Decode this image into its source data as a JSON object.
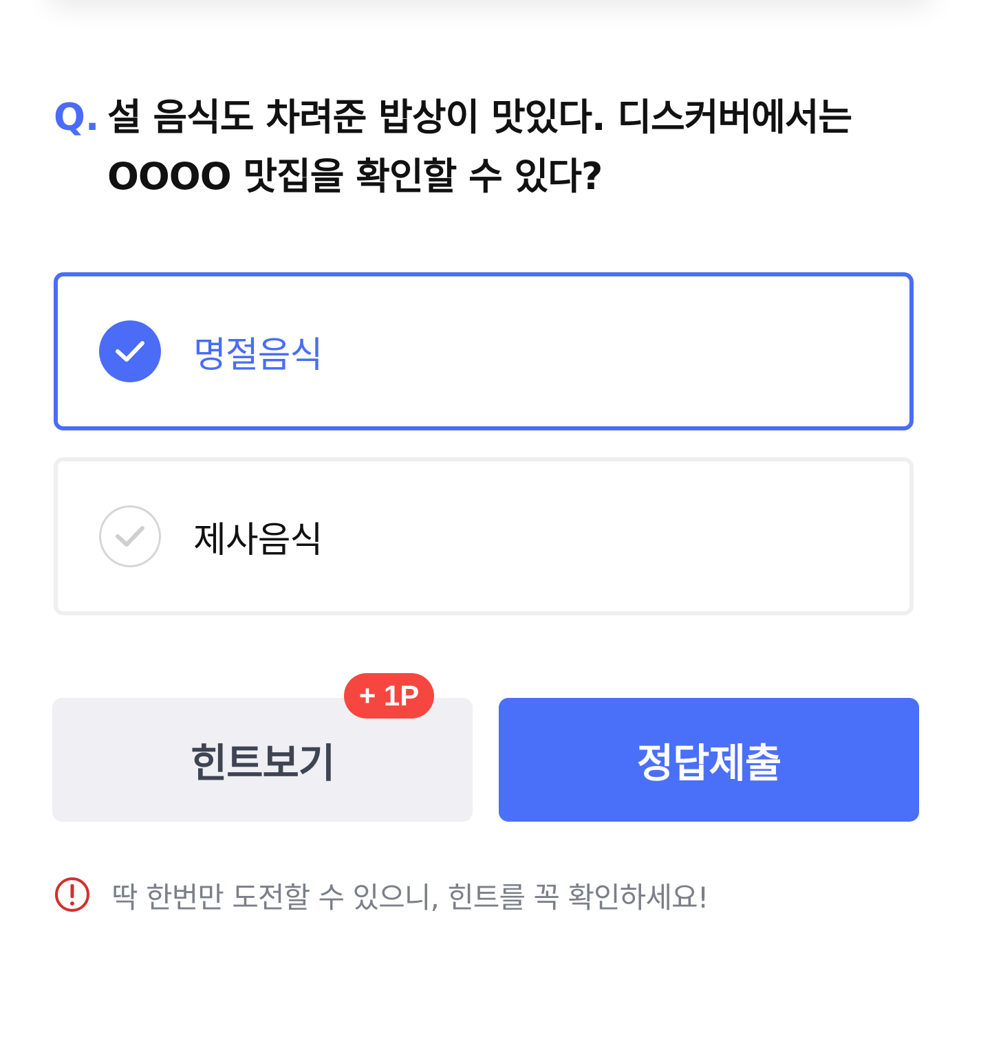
{
  "question": {
    "prefix": "Q.",
    "text": "설 음식도 차려준 밥상이 맛있다. 디스커버에서는 OOOO 맛집을 확인할 수 있다?"
  },
  "options": [
    {
      "label": "명절음식",
      "selected": true
    },
    {
      "label": "제사음식",
      "selected": false
    }
  ],
  "buttons": {
    "hint_label": "힌트보기",
    "hint_badge": "+ 1P",
    "submit_label": "정답제출"
  },
  "notice": {
    "icon": "exclamation-circle-icon",
    "text": "딱 한번만 도전할 수 있으니, 힌트를 꼭 확인하세요!"
  },
  "colors": {
    "accent": "#4a6cf7",
    "badge": "#f5473f",
    "warning": "#d32f2f"
  }
}
